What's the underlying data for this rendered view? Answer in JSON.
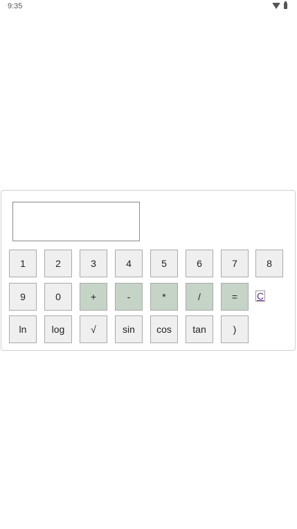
{
  "status_bar": {
    "time": "9:35",
    "icons": [
      "wifi-icon",
      "battery-icon"
    ]
  },
  "calculator": {
    "display_value": "",
    "keys": {
      "k1": "1",
      "k2": "2",
      "k3": "3",
      "k4": "4",
      "k5": "5",
      "k6": "6",
      "k7": "7",
      "k8": "8",
      "k9": "9",
      "k0": "0",
      "plus": "+",
      "minus": "-",
      "multiply": "*",
      "divide": "/",
      "equals": "=",
      "clear": "C",
      "ln": "ln",
      "log": "log",
      "sqrt": "√",
      "sin": "sin",
      "cos": "cos",
      "tan": "tan",
      "close_paren": ")"
    },
    "colors": {
      "digit_key_bg": "#efefef",
      "operator_key_bg": "#c5d4c7",
      "clear_link": "#5a2d82"
    }
  }
}
